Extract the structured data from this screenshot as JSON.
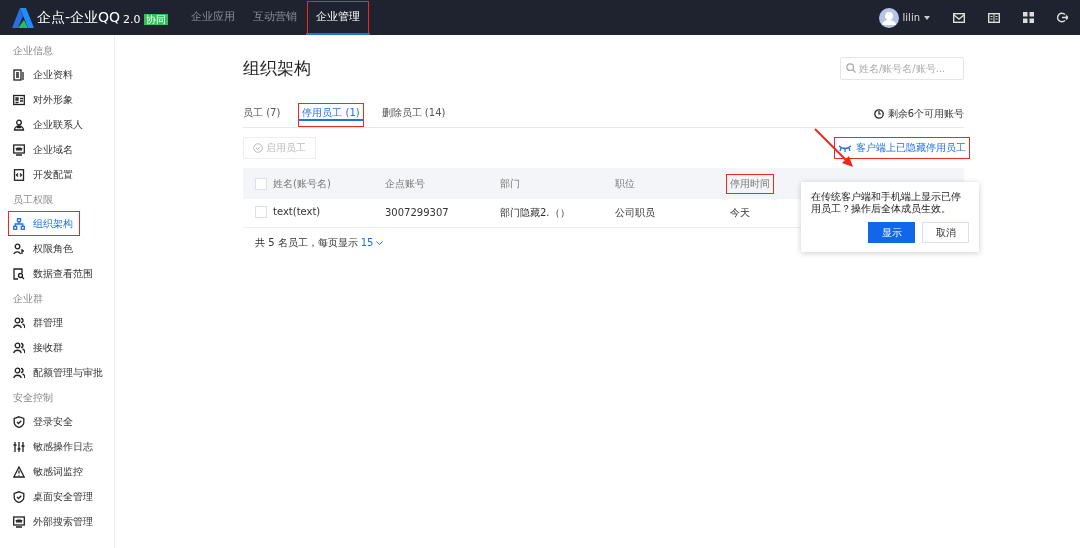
{
  "topbar": {
    "logo": "企点-企业QQ",
    "version": "2.0",
    "badge": "协同",
    "nav": [
      {
        "label": "企业应用",
        "selected": false,
        "annotated": false
      },
      {
        "label": "互动营销",
        "selected": false,
        "annotated": false
      },
      {
        "label": "企业管理",
        "selected": true,
        "annotated": true
      }
    ],
    "user": "lilin"
  },
  "sidebar": [
    {
      "title": "企业信息",
      "items": [
        {
          "label": "企业资料",
          "kind": "doc",
          "selected": false,
          "annotated": false
        },
        {
          "label": "对外形象",
          "kind": "card",
          "selected": false,
          "annotated": false
        },
        {
          "label": "企业联系人",
          "kind": "person",
          "selected": false,
          "annotated": false
        },
        {
          "label": "企业域名",
          "kind": "screen",
          "selected": false,
          "annotated": false
        },
        {
          "label": "开发配置",
          "kind": "code",
          "selected": false,
          "annotated": false
        }
      ]
    },
    {
      "title": "员工权限",
      "items": [
        {
          "label": "组织架构",
          "kind": "tree",
          "selected": true,
          "annotated": true
        },
        {
          "label": "权限角色",
          "kind": "role",
          "selected": false,
          "annotated": false
        },
        {
          "label": "数据查看范围",
          "kind": "search",
          "selected": false,
          "annotated": false
        }
      ]
    },
    {
      "title": "企业群",
      "items": [
        {
          "label": "群管理",
          "kind": "group",
          "selected": false,
          "annotated": false
        },
        {
          "label": "接收群",
          "kind": "group",
          "selected": false,
          "annotated": false
        },
        {
          "label": "配额管理与审批",
          "kind": "group",
          "selected": false,
          "annotated": false
        }
      ]
    },
    {
      "title": "安全控制",
      "items": [
        {
          "label": "登录安全",
          "kind": "shield",
          "selected": false,
          "annotated": false
        },
        {
          "label": "敏感操作日志",
          "kind": "sliders",
          "selected": false,
          "annotated": false
        },
        {
          "label": "敏感词监控",
          "kind": "warn",
          "selected": false,
          "annotated": false
        },
        {
          "label": "桌面安全管理",
          "kind": "shield",
          "selected": false,
          "annotated": false
        },
        {
          "label": "外部搜索管理",
          "kind": "screen",
          "selected": false,
          "annotated": false
        }
      ]
    }
  ],
  "page": {
    "title": "组织架构",
    "search": {
      "placeholder": "姓名/账号名/账号..."
    },
    "tabs": [
      {
        "label": "员工 (7)",
        "selected": false,
        "annotated": false
      },
      {
        "label": "停用员工 (1)",
        "selected": true,
        "annotated": true
      },
      {
        "label": "删除员工 (14)",
        "selected": false,
        "annotated": false
      }
    ],
    "remaining": "剩余6个可用账号",
    "hidden_link": "客户端上已隐藏停用员工",
    "enable_button": {
      "label": "启用员工",
      "disabled": true
    },
    "table": {
      "select_all_checked": false,
      "columns": [
        {
          "label": "姓名(账号名)",
          "annotated": false
        },
        {
          "label": "企点账号",
          "annotated": false
        },
        {
          "label": "部门",
          "annotated": false
        },
        {
          "label": "职位",
          "annotated": false
        },
        {
          "label": "停用时间",
          "annotated": true
        }
      ],
      "rows": [
        {
          "checked": false,
          "cells": [
            "text(text)",
            "3007299307",
            "部门隐藏2.（）",
            "公司职员",
            "今天"
          ]
        }
      ]
    },
    "footer": {
      "summary": "共 5 名员工，每页显示",
      "page_size": "15"
    },
    "popover": {
      "text": "在传统客户端和手机端上显示已停用员工？操作后全体成员生效。",
      "confirm": "显示",
      "cancel": "取消"
    }
  }
}
